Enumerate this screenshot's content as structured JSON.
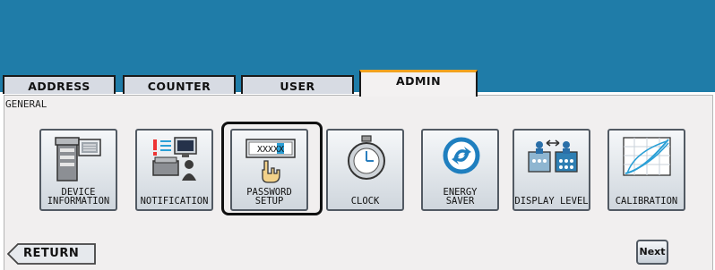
{
  "tabs": [
    {
      "label": "ADDRESS"
    },
    {
      "label": "COUNTER"
    },
    {
      "label": "USER"
    },
    {
      "label": "ADMIN",
      "active": true
    }
  ],
  "section_title": "GENERAL",
  "tiles": [
    {
      "label": "DEVICE\nINFORMATION",
      "icon": "device-information-icon"
    },
    {
      "label": "NOTIFICATION",
      "icon": "notification-icon"
    },
    {
      "label": "PASSWORD SETUP",
      "icon": "password-setup-icon",
      "keypad_text": "XXXXX",
      "selected": true
    },
    {
      "label": "CLOCK",
      "icon": "stopwatch-icon"
    },
    {
      "label": "ENERGY\nSAVER",
      "icon": "energy-saver-icon"
    },
    {
      "label": "DISPLAY LEVEL",
      "icon": "display-level-icon"
    },
    {
      "label": "CALIBRATION",
      "icon": "calibration-icon"
    }
  ],
  "footer": {
    "return_label": "RETURN",
    "next_label": "Next"
  },
  "colors": {
    "header": "#1f7ca8",
    "active_tab_accent": "#f0a21f",
    "panel": "#f1efef"
  }
}
